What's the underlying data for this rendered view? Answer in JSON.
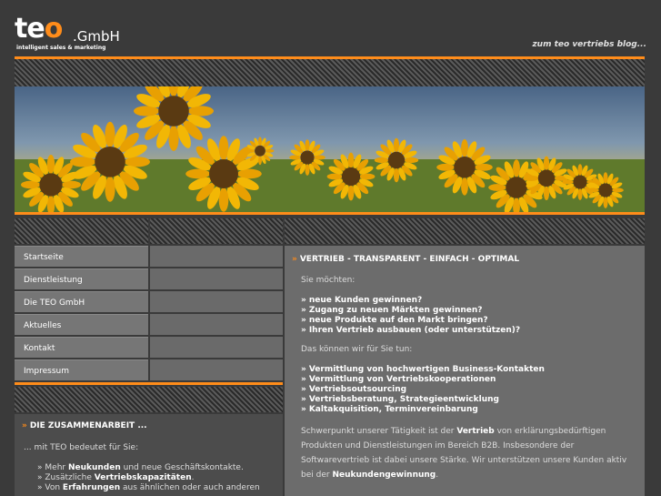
{
  "logo": {
    "text_te": "te",
    "text_o": "o",
    "gmbh": ".GmbH",
    "tagline": "intelligent sales & marketing"
  },
  "header": {
    "blog_link": "zum teo vertriebs blog..."
  },
  "nav": {
    "items": [
      {
        "label": "Startseite"
      },
      {
        "label": "Dienstleistung"
      },
      {
        "label": "Die TEO GmbH"
      },
      {
        "label": "Aktuelles"
      },
      {
        "label": "Kontakt"
      },
      {
        "label": "Impressum"
      }
    ]
  },
  "main": {
    "heading": "VERTRIEB - TRANSPARENT - EINFACH - OPTIMAL",
    "intro": "Sie möchten:",
    "wants": [
      "neue Kunden gewinnen?",
      "Zugang zu neuen Märkten gewinnen?",
      "neue Produkte auf den Markt bringen?",
      "Ihren Vertrieb ausbauen (oder unterstützen)?"
    ],
    "offer_intro": "Das können wir für Sie tun:",
    "offers": [
      "Vermittlung von hochwertigen Business-Kontakten",
      "Vermittlung von Vertriebskooperationen",
      "Vertriebsoutsourcing",
      "Vertriebsberatung, Strategieentwicklung",
      "Kaltakquisition, Terminvereinbarung"
    ],
    "focus": {
      "p1": "Schwerpunkt unserer Tätigkeit ist der ",
      "b1": "Vertrieb",
      "p2": " von erklärungsbedürftigen Produkten und Dienstleistungen im Bereich B2B. Insbesondere der Softwarevertrieb ist dabei unsere Stärke. Wir unterstützen unsere Kunden aktiv bei der ",
      "b2": "Neukundengewinnung",
      "p3": "."
    }
  },
  "about": {
    "heading": "DIE ZUSAMMENARBEIT ...",
    "intro": "... mit TEO bedeutet für Sie:",
    "items": [
      {
        "pre": "Mehr ",
        "bold": "Neukunden",
        "post": " und neue Geschäftskontakte."
      },
      {
        "pre": "Zusätzliche ",
        "bold": "Vertriebskapazitäten",
        "post": "."
      },
      {
        "pre": "Von ",
        "bold": "Erfahrungen",
        "post": " aus ähnlichen oder auch anderen"
      }
    ]
  },
  "bullet": "»",
  "arrow": "»",
  "colors": {
    "accent": "#ff8c1a",
    "background": "#3a3a3a",
    "panel": "#6c6c6c"
  }
}
